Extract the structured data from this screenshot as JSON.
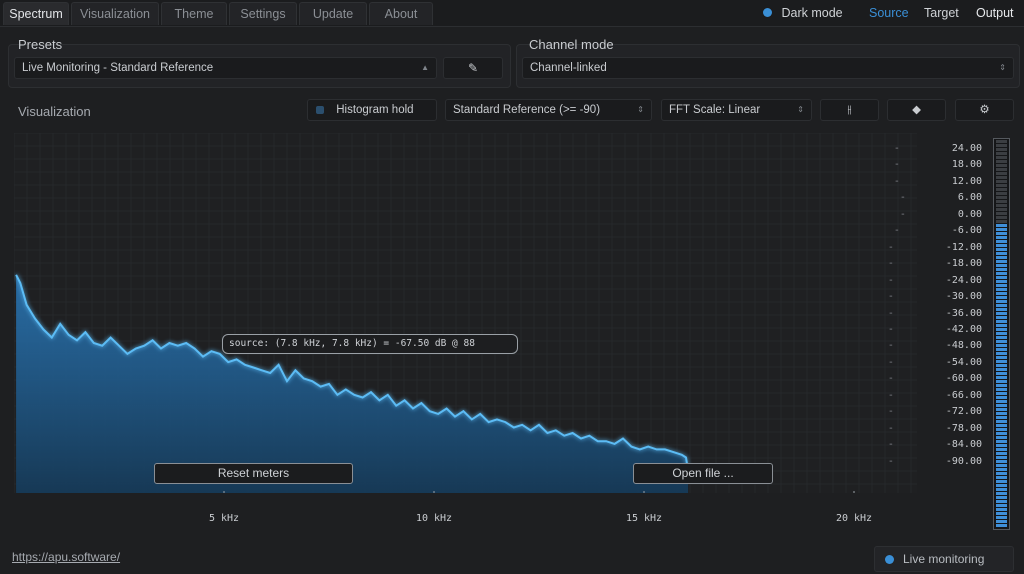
{
  "tabs": [
    "Spectrum",
    "Visualization",
    "Theme",
    "Settings",
    "Update",
    "About"
  ],
  "top_right": {
    "dark_mode_label": "Dark mode",
    "source": "Source",
    "target": "Target",
    "output": "Output"
  },
  "presets": {
    "title": "Presets",
    "selected": "Live Monitoring - Standard Reference"
  },
  "channel_mode": {
    "title": "Channel mode",
    "selected": "Channel-linked"
  },
  "visualization": {
    "title": "Visualization",
    "histogram_hold": "Histogram hold",
    "reference": "Standard Reference (>= -90)",
    "fft_scale": "FFT Scale: Linear"
  },
  "tooltip": "source: (7.8 kHz, 7.8 kHz) = -67.50 dB @ 88",
  "buttons": {
    "reset_meters": "Reset meters",
    "open_file": "Open file ..."
  },
  "footer": {
    "link": "https://apu.software/",
    "live_monitoring": "Live monitoring"
  },
  "colors": {
    "accent": "#3a8fd6",
    "spectrum_line": "#4fb3f0",
    "spectrum_fill": "#1f5c8c"
  },
  "chart_data": {
    "type": "area",
    "x_ticks": [
      "5 kHz",
      "10 kHz",
      "15 kHz",
      "20 kHz"
    ],
    "y_ticks": [
      "24.00",
      "18.00",
      "12.00",
      "6.00",
      "0.00",
      "-6.00",
      "-12.00",
      "-18.00",
      "-24.00",
      "-30.00",
      "-36.00",
      "-42.00",
      "-48.00",
      "-54.00",
      "-60.00",
      "-66.00",
      "-72.00",
      "-78.00",
      "-84.00",
      "-90.00"
    ],
    "x_range_khz": [
      0,
      21.5
    ],
    "y_range_db": [
      30,
      -102
    ],
    "series": [
      {
        "x_khz": [
          0.05,
          0.15,
          0.3,
          0.5,
          0.7,
          0.9,
          1.1,
          1.3,
          1.5,
          1.7,
          1.9,
          2.1,
          2.3,
          2.5,
          2.7,
          2.9,
          3.1,
          3.3,
          3.5,
          3.7,
          3.9,
          4.1,
          4.3,
          4.5,
          4.7,
          4.9,
          5.1,
          5.3,
          5.5,
          5.7,
          5.9,
          6.1,
          6.3,
          6.5,
          6.7,
          6.9,
          7.1,
          7.3,
          7.5,
          7.7,
          7.9,
          8.1,
          8.3,
          8.5,
          8.7,
          8.9,
          9.1,
          9.3,
          9.5,
          9.7,
          9.9,
          10.1,
          10.3,
          10.5,
          10.7,
          10.9,
          11.1,
          11.3,
          11.5,
          11.7,
          11.9,
          12.1,
          12.3,
          12.5,
          12.7,
          12.9,
          13.1,
          13.3,
          13.5,
          13.7,
          13.9,
          14.1,
          14.3,
          14.5,
          14.7,
          14.9,
          15.1,
          15.3,
          15.5,
          15.7,
          15.9,
          16.0,
          16.05
        ],
        "db": [
          -22,
          -25,
          -33,
          -38,
          -42,
          -45,
          -40,
          -44,
          -46,
          -43,
          -47,
          -48,
          -45,
          -48,
          -51,
          -49,
          -48,
          -46,
          -49,
          -47,
          -48,
          -47,
          -49,
          -52,
          -50,
          -51,
          -54,
          -53,
          -55,
          -56,
          -57,
          -58,
          -55,
          -61,
          -57,
          -60,
          -61,
          -63,
          -62,
          -66,
          -64,
          -66,
          -67,
          -65,
          -68,
          -66,
          -70,
          -68,
          -71,
          -69,
          -72,
          -73,
          -71,
          -74,
          -72,
          -75,
          -73,
          -76,
          -75,
          -76,
          -78,
          -77,
          -79,
          -77,
          -80,
          -79,
          -81,
          -80,
          -82,
          -81,
          -83,
          -83,
          -84,
          -82,
          -85,
          -86,
          -85,
          -86,
          -86,
          -87,
          -88,
          -89,
          -94
        ]
      }
    ]
  }
}
